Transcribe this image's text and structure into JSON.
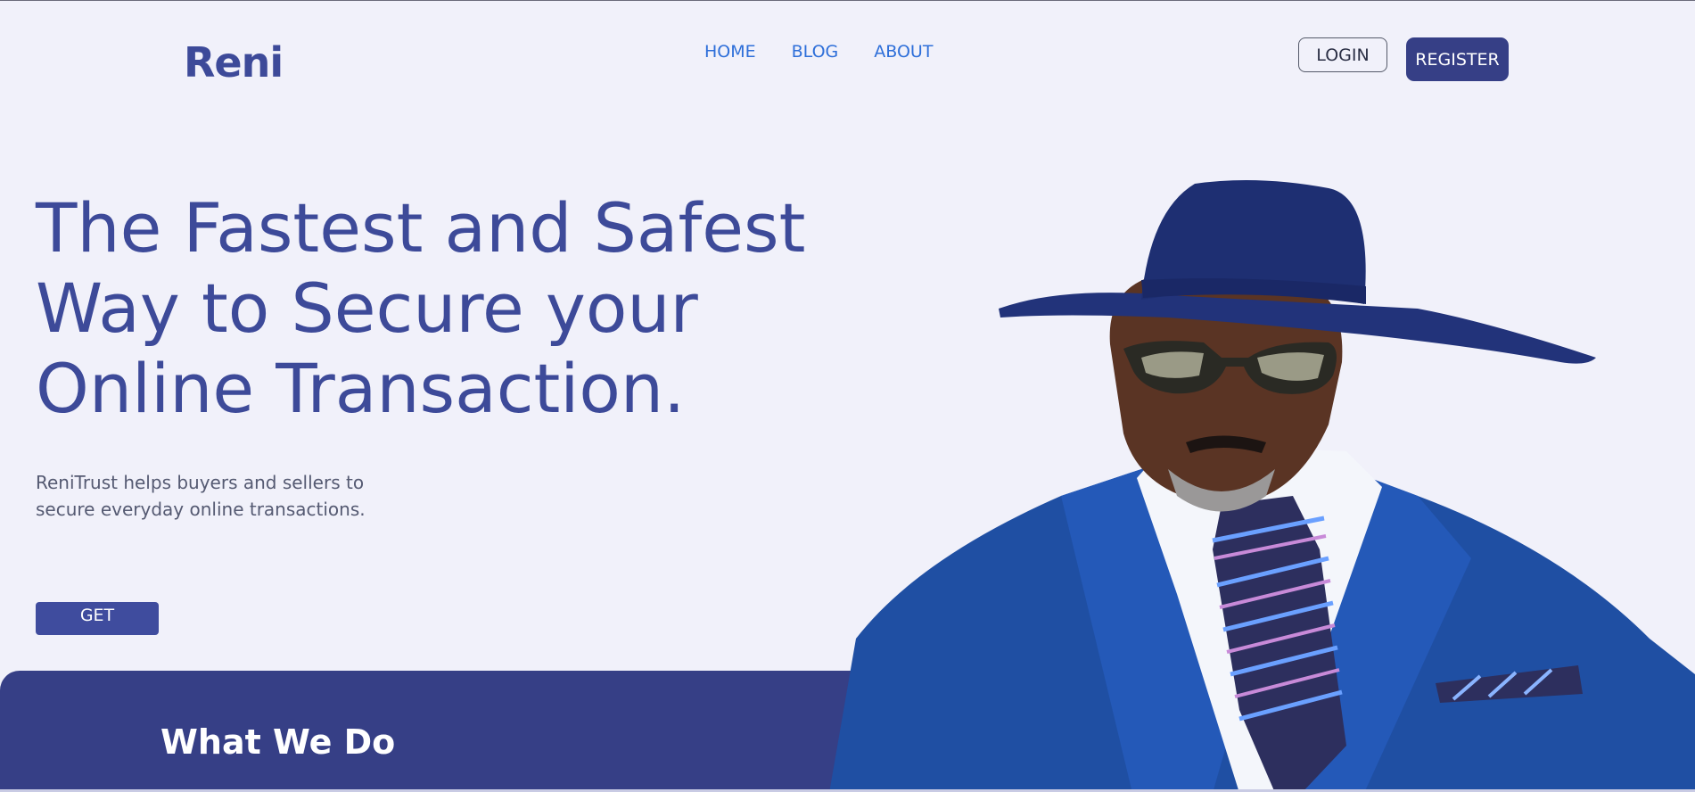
{
  "brand": {
    "logo_text": "Reni"
  },
  "nav": {
    "items": [
      "HOME",
      "BLOG",
      "ABOUT"
    ]
  },
  "auth": {
    "login_label": "LOGIN",
    "register_label": "REGISTER"
  },
  "hero": {
    "title_lines": [
      "The Fastest and Safest",
      "Way to Secure your",
      "Online Transaction."
    ],
    "subtitle_lines": [
      "ReniTrust helps buyers and sellers to",
      "secure everyday online transactions."
    ],
    "cta_label": "GET"
  },
  "section": {
    "title": "What We Do"
  },
  "colors": {
    "background": "#f1f1fa",
    "brand": "#3d4a99",
    "brand_dark": "#363f86",
    "nav_link": "#2e6fd9"
  },
  "image": {
    "subject": "man-in-hat-and-suit-photo"
  }
}
